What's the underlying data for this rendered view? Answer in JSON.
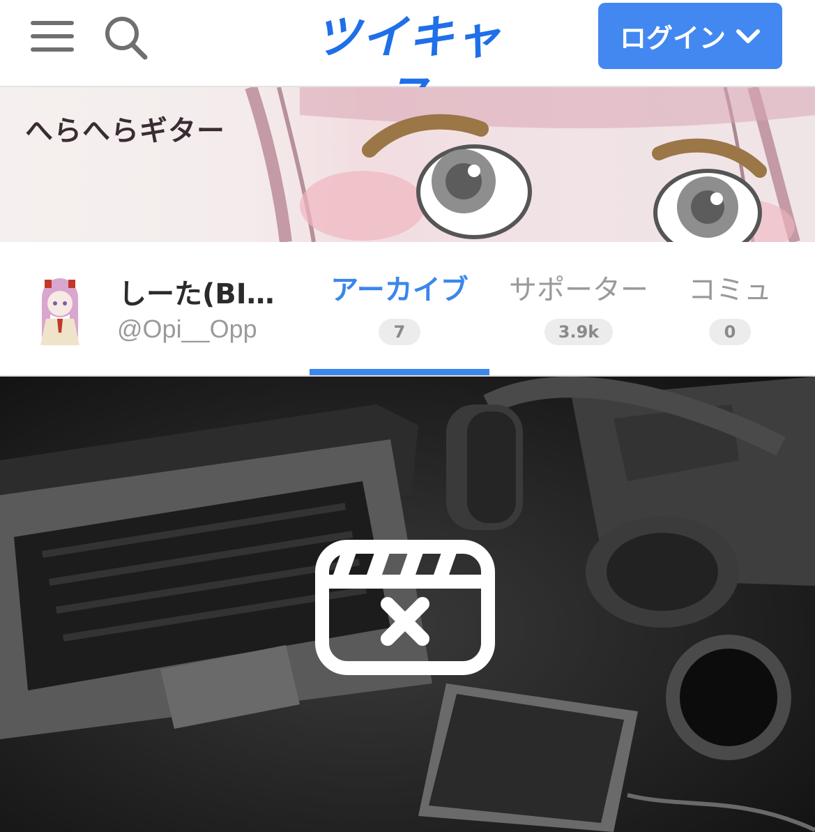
{
  "header": {
    "logo": "ツイキャス",
    "login_label": "ログイン",
    "menu_icon": "hamburger-menu-icon",
    "search_icon": "search-icon",
    "login_chevron_icon": "chevron-down-icon",
    "brand_color": "#1f6fe8",
    "button_color": "#4388f0"
  },
  "banner": {
    "title": "へらへらギター"
  },
  "profile": {
    "name": "しーた(BI…",
    "handle": "@Opi__Opp"
  },
  "tabs": [
    {
      "label": "アーカイブ",
      "count": "7",
      "active": true
    },
    {
      "label": "サポーター",
      "count": "3.9k",
      "active": false
    },
    {
      "label": "コミュ",
      "count": "0",
      "active": false
    }
  ],
  "video": {
    "status_icon": "video-unavailable-icon"
  }
}
